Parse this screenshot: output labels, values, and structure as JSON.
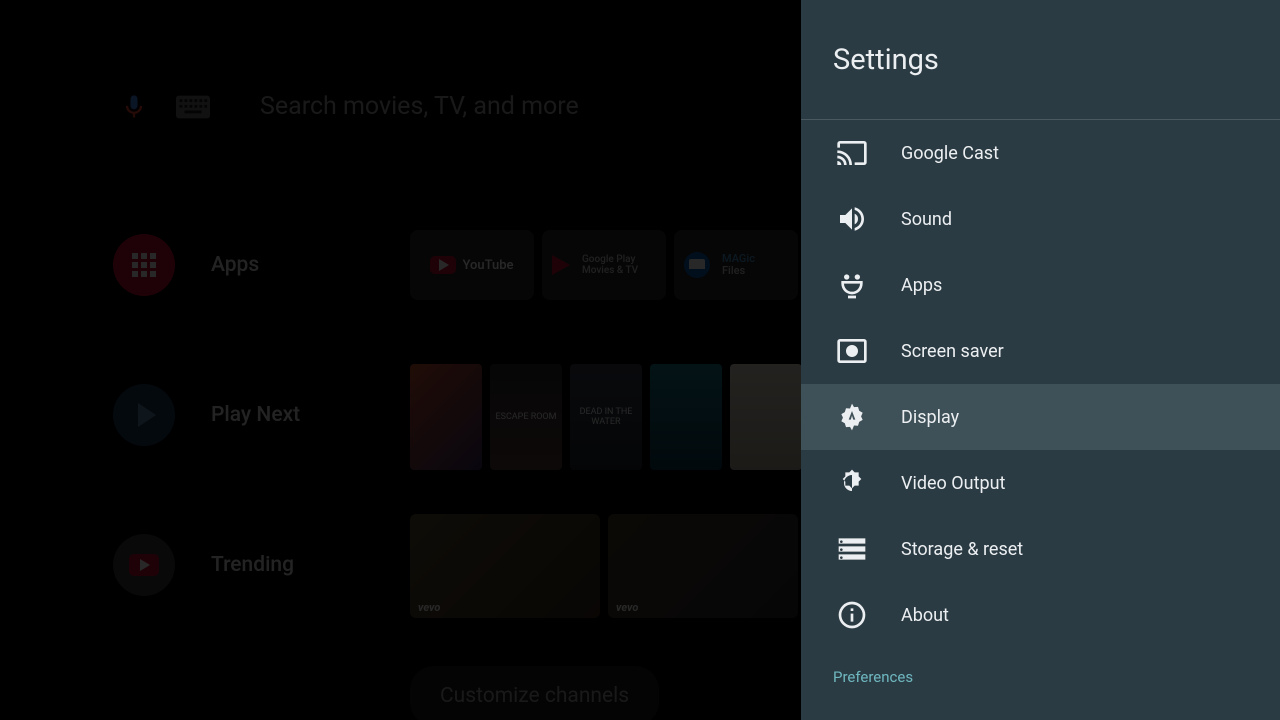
{
  "search": {
    "placeholder": "Search movies, TV, and more"
  },
  "home_rows": {
    "apps": {
      "label": "Apps"
    },
    "play_next": {
      "label": "Play Next"
    },
    "trending": {
      "label": "Trending"
    }
  },
  "app_tiles": {
    "youtube": {
      "label": "YouTube"
    },
    "google_play": {
      "line1": "Google Play",
      "line2": "Movies & TV"
    },
    "magic_files": {
      "line1": "MAGic",
      "line2": "Files"
    }
  },
  "movie_tiles": {
    "m1": "",
    "m2": "ESCAPE ROOM",
    "m3": "DEAD IN THE WATER",
    "m4": "",
    "m5": ""
  },
  "trending_tiles": {
    "tag": "vevo"
  },
  "customize_label": "Customize channels",
  "settings": {
    "title": "Settings",
    "items": [
      {
        "label": "Google Cast",
        "icon": "cast-icon"
      },
      {
        "label": "Sound",
        "icon": "sound-icon"
      },
      {
        "label": "Apps",
        "icon": "apps-icon"
      },
      {
        "label": "Screen saver",
        "icon": "screensaver-icon"
      },
      {
        "label": "Display",
        "icon": "display-icon"
      },
      {
        "label": "Video Output",
        "icon": "video-output-icon"
      },
      {
        "label": "Storage & reset",
        "icon": "storage-icon"
      },
      {
        "label": "About",
        "icon": "about-icon"
      }
    ],
    "selected_index": 4,
    "section_header": "Preferences"
  }
}
